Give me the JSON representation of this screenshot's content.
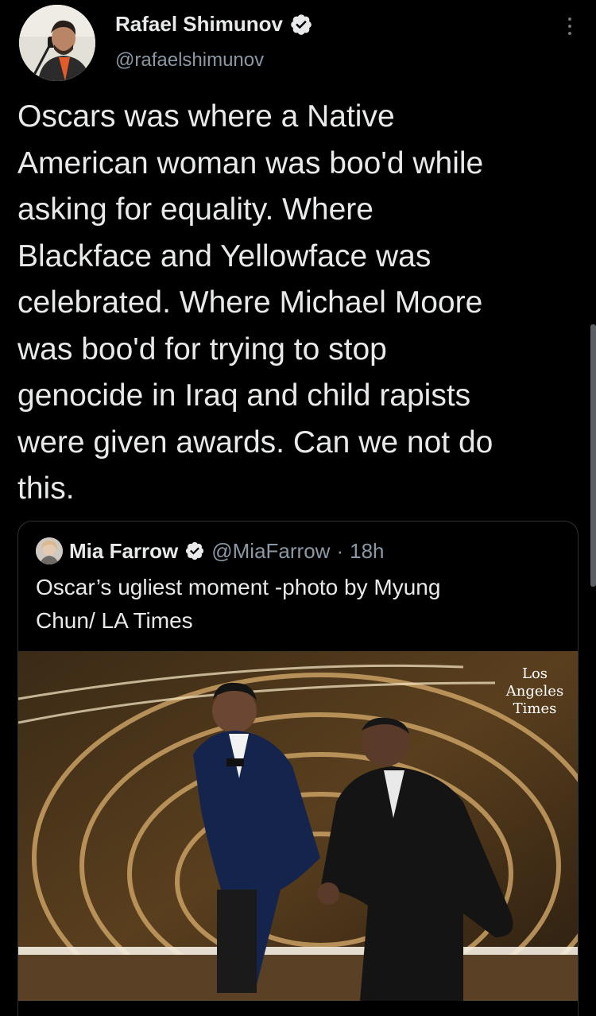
{
  "tweet": {
    "author": {
      "display_name": "Rafael Shimunov",
      "handle": "@rafaelshimunov",
      "verified": true
    },
    "text": "Oscars was where a Native\nAmerican woman was boo'd while\nasking for equality. Where\nBlackface and Yellowface was\ncelebrated. Where Michael Moore\nwas boo'd for trying to stop\ngenocide in Iraq and child rapists\nwere given awards. Can we not do\nthis.",
    "menu_icon": "more-vertical-icon"
  },
  "quoted": {
    "author": {
      "display_name": "Mia Farrow",
      "handle": "@MiaFarrow",
      "separator": " · ",
      "time": "18h",
      "verified": true
    },
    "text": "Oscar’s ugliest moment -photo by Myung\nChun/ LA Times",
    "photo": {
      "watermark_lines": [
        "Los",
        "Angeles",
        "Times"
      ]
    }
  },
  "colors": {
    "background": "#000000",
    "text_primary": "#e7e9ea",
    "text_secondary": "#8b98a5",
    "border": "#2f3336",
    "verified_badge": "#e7e9ea"
  }
}
